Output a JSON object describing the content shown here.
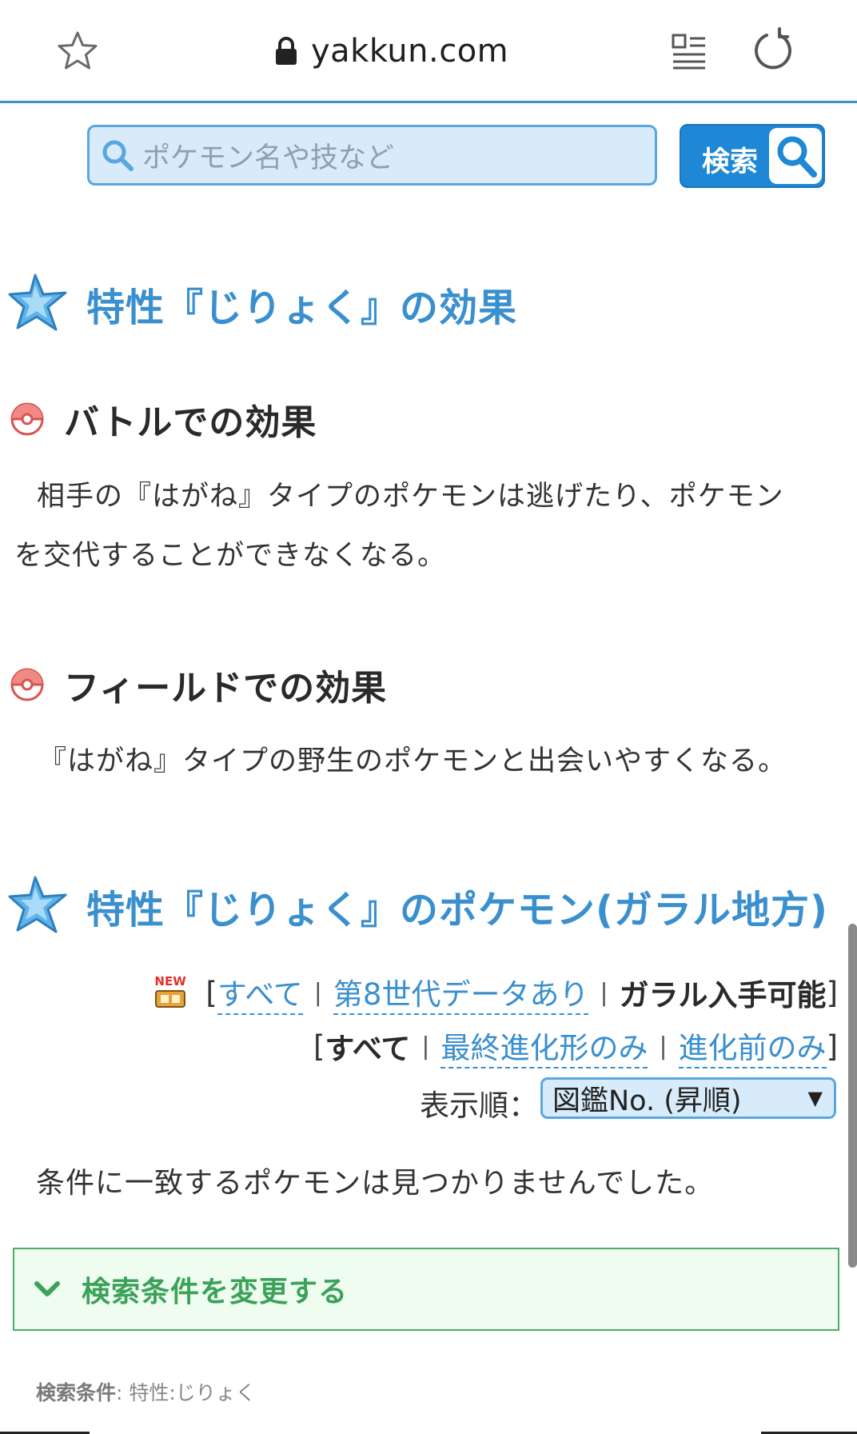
{
  "browser": {
    "url": "yakkun.com",
    "icons": [
      "star-icon",
      "lock-icon",
      "reader-mode-icon",
      "reload-icon"
    ]
  },
  "search": {
    "placeholder": "ポケモン名や技など",
    "button_label": "検索"
  },
  "section_effect": {
    "title": "特性『じりょく』の効果",
    "battle": {
      "heading": "バトルでの効果",
      "text_line1": "相手の『はがね』タイプのポケモンは逃げたり、ポケモン",
      "text_line2": "を交代することができなくなる。"
    },
    "field": {
      "heading": "フィールドでの効果",
      "text": "『はがね』タイプの野生のポケモンと出会いやすくなる。"
    }
  },
  "section_pokemon": {
    "title": "特性『じりょく』のポケモン(ガラル地方)",
    "new_badge": "NEW",
    "filter_row1": {
      "all": "すべて",
      "gen8": "第8世代データあり",
      "galar": "ガラル入手可能"
    },
    "filter_row2": {
      "all": "すべて",
      "final": "最終進化形のみ",
      "pre": "進化前のみ"
    },
    "sort": {
      "label": "表示順：",
      "selected": "図鑑No. (昇順)"
    },
    "no_result": "条件に一致するポケモンは見つかりませんでした。",
    "change_conditions": "検索条件を変更する",
    "conditions_label": "検索条件",
    "conditions_value": ": 特性:じりょく"
  },
  "colors": {
    "accent_blue": "#3a8fcf",
    "search_blue": "#1e88d6",
    "green": "#3ca25a",
    "pokeball_red": "#d9534f"
  }
}
